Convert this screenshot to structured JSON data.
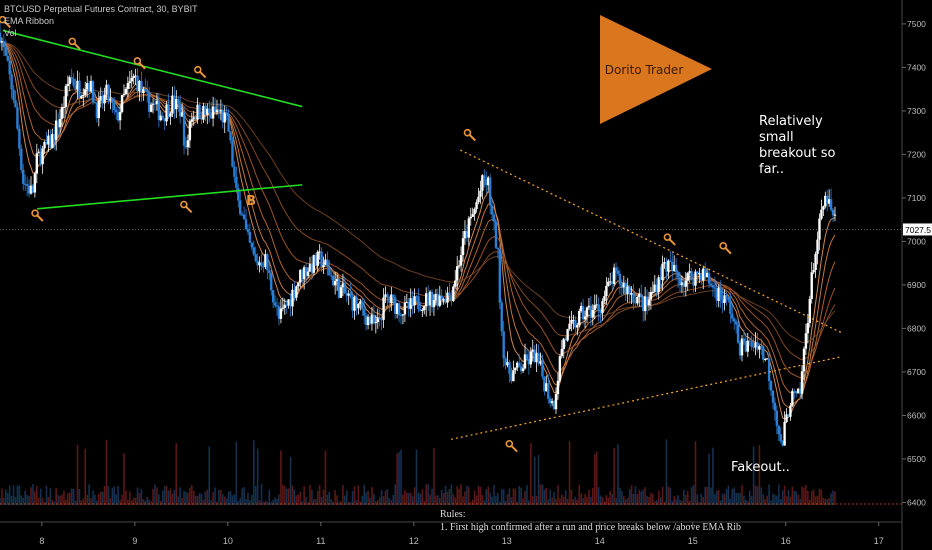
{
  "chart_data": {
    "type": "candlestick",
    "title": "BTCUSD Perpetual Futures Contract, 30, BYBIT",
    "indicators": [
      "EMA Ribbon",
      "Vol"
    ],
    "x_ticks": [
      "8",
      "9",
      "10",
      "11",
      "12",
      "13",
      "14",
      "15",
      "16",
      "17"
    ],
    "y_ticks": [
      6400,
      6500,
      6600,
      6700,
      6800,
      6900,
      7000,
      7100,
      7200,
      7300,
      7400,
      7500
    ],
    "ylim": [
      6355,
      7555
    ],
    "xlim": [
      7.55,
      17.25
    ],
    "current_price": "7027.5",
    "colors": {
      "up": "#ffffff",
      "down": "#2b7fd6",
      "up_vol": "#5a1818",
      "down_vol": "#16304d",
      "trendline_green": "#22dd22",
      "trendline_orange": "#f5a623",
      "logo": "#d9761e",
      "ribbon": "#c06a2a"
    },
    "price_path": [
      [
        7.55,
        7480
      ],
      [
        7.7,
        7330
      ],
      [
        7.8,
        7140
      ],
      [
        7.9,
        7110
      ],
      [
        7.95,
        7190
      ],
      [
        8.1,
        7230
      ],
      [
        8.22,
        7300
      ],
      [
        8.3,
        7380
      ],
      [
        8.4,
        7350
      ],
      [
        8.5,
        7370
      ],
      [
        8.6,
        7300
      ],
      [
        8.7,
        7340
      ],
      [
        8.8,
        7280
      ],
      [
        8.9,
        7340
      ],
      [
        9.0,
        7380
      ],
      [
        9.1,
        7330
      ],
      [
        9.2,
        7310
      ],
      [
        9.3,
        7290
      ],
      [
        9.4,
        7320
      ],
      [
        9.5,
        7300
      ],
      [
        9.55,
        7200
      ],
      [
        9.6,
        7290
      ],
      [
        9.7,
        7300
      ],
      [
        9.8,
        7290
      ],
      [
        9.9,
        7300
      ],
      [
        10.0,
        7270
      ],
      [
        10.05,
        7180
      ],
      [
        10.1,
        7090
      ],
      [
        10.15,
        7080
      ],
      [
        10.2,
        7010
      ],
      [
        10.3,
        6950
      ],
      [
        10.4,
        6960
      ],
      [
        10.55,
        6820
      ],
      [
        10.65,
        6860
      ],
      [
        10.8,
        6930
      ],
      [
        11.0,
        6960
      ],
      [
        11.2,
        6890
      ],
      [
        11.4,
        6850
      ],
      [
        11.6,
        6800
      ],
      [
        11.7,
        6870
      ],
      [
        11.9,
        6840
      ],
      [
        12.05,
        6860
      ],
      [
        12.2,
        6870
      ],
      [
        12.4,
        6880
      ],
      [
        12.55,
        7010
      ],
      [
        12.65,
        7070
      ],
      [
        12.75,
        7140
      ],
      [
        12.8,
        7130
      ],
      [
        12.85,
        7040
      ],
      [
        12.9,
        6980
      ],
      [
        12.95,
        6780
      ],
      [
        13.0,
        6700
      ],
      [
        13.1,
        6700
      ],
      [
        13.3,
        6740
      ],
      [
        13.5,
        6620
      ],
      [
        13.6,
        6770
      ],
      [
        13.8,
        6830
      ],
      [
        14.0,
        6850
      ],
      [
        14.15,
        6920
      ],
      [
        14.3,
        6890
      ],
      [
        14.5,
        6850
      ],
      [
        14.6,
        6900
      ],
      [
        14.7,
        6950
      ],
      [
        14.8,
        6930
      ],
      [
        14.9,
        6910
      ],
      [
        15.1,
        6930
      ],
      [
        15.2,
        6900
      ],
      [
        15.4,
        6850
      ],
      [
        15.5,
        6760
      ],
      [
        15.6,
        6760
      ],
      [
        15.7,
        6770
      ],
      [
        15.8,
        6720
      ],
      [
        15.9,
        6600
      ],
      [
        15.95,
        6520
      ],
      [
        16.05,
        6640
      ],
      [
        16.15,
        6640
      ],
      [
        16.22,
        6800
      ],
      [
        16.3,
        6950
      ],
      [
        16.4,
        7080
      ],
      [
        16.45,
        7100
      ],
      [
        16.5,
        7050
      ],
      [
        16.55,
        7060
      ]
    ],
    "trendlines": [
      {
        "color": "green",
        "points": [
          [
            7.58,
            7485
          ],
          [
            10.8,
            7310
          ]
        ]
      },
      {
        "color": "green",
        "points": [
          [
            7.95,
            7075
          ],
          [
            10.8,
            7130
          ]
        ]
      },
      {
        "color": "orange",
        "points": [
          [
            12.5,
            7210
          ],
          [
            16.6,
            6790
          ]
        ]
      },
      {
        "color": "orange",
        "points": [
          [
            12.4,
            6545
          ],
          [
            16.6,
            6735
          ]
        ]
      }
    ],
    "annotations": [
      {
        "text": "Relatively small breakout so far..",
        "x": 16.1,
        "y": 7200
      },
      {
        "text": "Fakeout..",
        "x": 15.95,
        "y": 6490
      },
      {
        "text": "Dorito Trader",
        "x": 14.6,
        "y": 7400
      }
    ],
    "rules_text": [
      "Rules:",
      "1. First high confirmed after a run and price breaks below /above EMA Rib"
    ],
    "markers": [
      {
        "label": "B",
        "x": 10.25,
        "y": 7095
      }
    ]
  }
}
